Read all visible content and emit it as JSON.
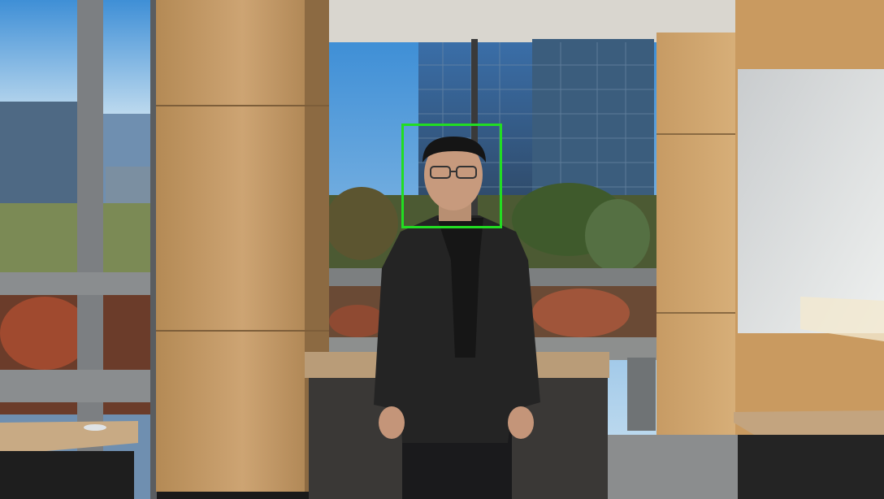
{
  "scene": {
    "detection": {
      "label": "face",
      "box_color": "#22dd22"
    }
  }
}
